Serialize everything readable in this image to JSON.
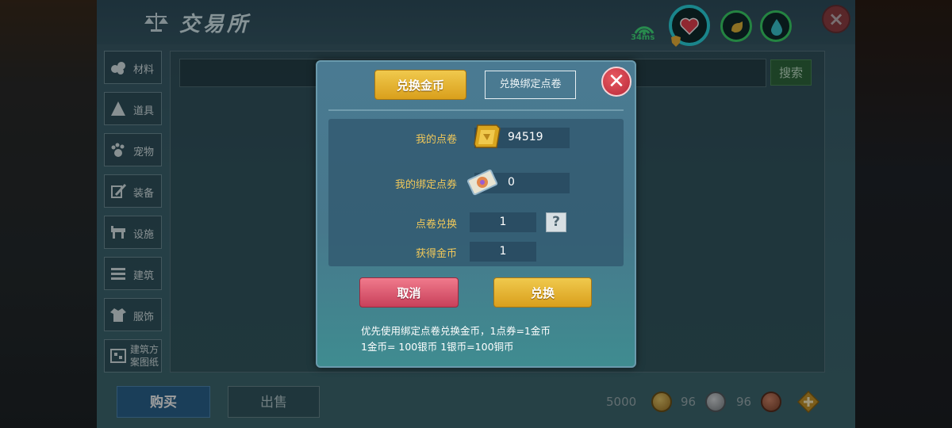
{
  "panel": {
    "title": "交易所",
    "sidebar": [
      {
        "label": "材料",
        "icon": "materials-icon"
      },
      {
        "label": "道具",
        "icon": "props-icon"
      },
      {
        "label": "宠物",
        "icon": "pet-paw-icon"
      },
      {
        "label": "装备",
        "icon": "equipment-icon"
      },
      {
        "label": "设施",
        "icon": "facility-icon"
      },
      {
        "label": "建筑",
        "icon": "building-icon"
      },
      {
        "label": "服饰",
        "icon": "clothing-icon"
      },
      {
        "label": "建筑方案图纸",
        "label_line1": "建筑方",
        "label_line2": "案图纸",
        "icon": "blueprint-icon"
      }
    ],
    "search_button": "搜索",
    "tabs": {
      "buy": "购买",
      "sell": "出售"
    },
    "currency": {
      "gold": "5000",
      "silver": "96",
      "copper": "96"
    }
  },
  "hud": {
    "ping": "34ms",
    "colors": {
      "ping": "#42e07e",
      "health": "#e8414f",
      "hunger": "#e2b73a",
      "water": "#3bc8d2"
    }
  },
  "modal": {
    "tab_coin": "兑换金币",
    "tab_bound": "兑换绑定点卷",
    "my_points_label": "我的点卷",
    "my_points_value": "94519",
    "my_bound_label": "我的绑定点券",
    "my_bound_value": "0",
    "exchange_label": "点卷兑换",
    "exchange_value": "1",
    "obtain_label": "获得金币",
    "obtain_value": "1",
    "cancel": "取消",
    "confirm": "兑换",
    "note_line1": "优先使用绑定点卷兑换金币，1点券=1金币",
    "note_line2": "1金币= 100银币  1银币=100铜币"
  }
}
